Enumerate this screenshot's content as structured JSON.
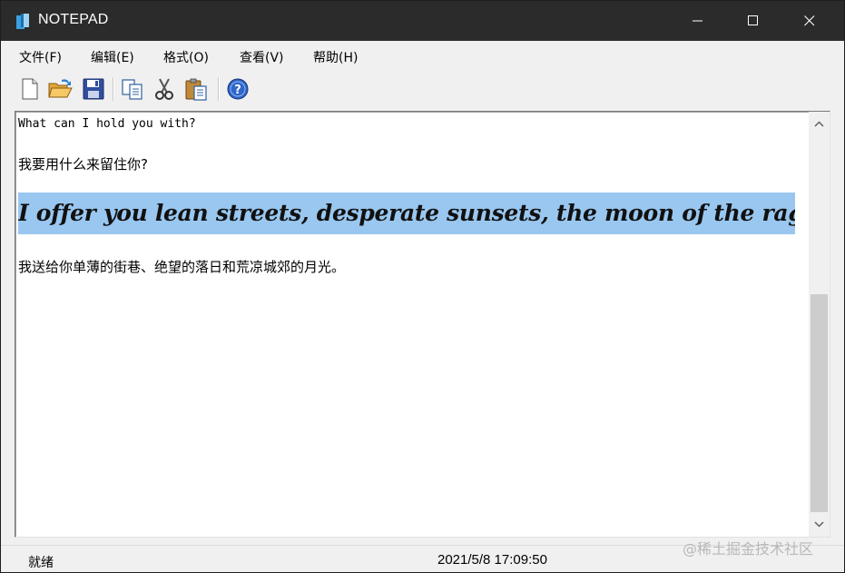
{
  "window": {
    "title": "NOTEPAD",
    "icon": "notepad-app-icon",
    "controls": [
      "minimize-icon",
      "maximize-icon",
      "close-icon"
    ]
  },
  "menu": {
    "file": "文件(F)",
    "edit": "编辑(E)",
    "format": "格式(O)",
    "view": "查看(V)",
    "help": "帮助(H)"
  },
  "toolbar": {
    "icons": [
      "new-file-icon",
      "open-folder-icon",
      "save-disk-icon",
      "copy-icon",
      "cut-scissors-icon",
      "paste-clipboard-icon",
      "help-icon"
    ]
  },
  "document": {
    "lines": [
      "What can I hold you with?",
      "我要用什么来留住你?",
      "I offer you lean streets, desperate sunsets, the moon of the ragged suburbs.",
      "我送给你单薄的街巷、绝望的落日和荒凉城郊的月光。"
    ],
    "highlight_color": "#99c7f0"
  },
  "status": {
    "state": "就绪",
    "datetime": "2021/5/8 17:09:50"
  },
  "watermark": "@稀土掘金技术社区",
  "colors": {
    "titlebar": "#2b2b2b",
    "chrome": "#f0f0f0",
    "selection": "#99c7f0"
  }
}
